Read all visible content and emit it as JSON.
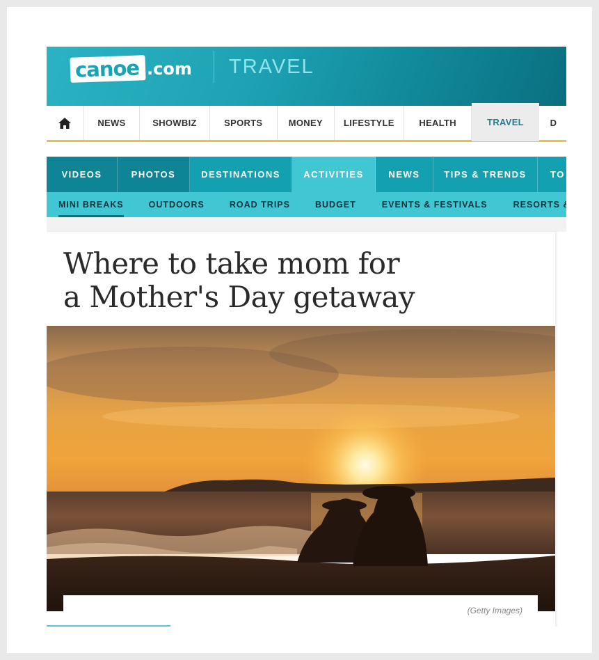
{
  "header": {
    "logo_main": "canoe",
    "logo_suffix": ".com",
    "section_title": "TRAVEL",
    "brand_color": "#1da2b3"
  },
  "main_nav": {
    "home_icon": "home-icon",
    "items": [
      "NEWS",
      "SHOWBIZ",
      "SPORTS",
      "MONEY",
      "LIFESTYLE",
      "HEALTH",
      "TRAVEL",
      "D"
    ],
    "active": "TRAVEL",
    "underline_color": "#e9c24a"
  },
  "section_nav": {
    "items": [
      "VIDEOS",
      "PHOTOS",
      "DESTINATIONS",
      "ACTIVITIES",
      "NEWS",
      "TIPS & TRENDS",
      "TO"
    ],
    "active": "ACTIVITIES"
  },
  "sub_nav": {
    "items": [
      "MINI BREAKS",
      "OUTDOORS",
      "ROAD TRIPS",
      "BUDGET",
      "EVENTS & FESTIVALS",
      "RESORTS & CR"
    ],
    "active": "MINI BREAKS"
  },
  "article": {
    "headline_line1": "Where to take mom for",
    "headline_line2": "a Mother's Day getaway",
    "photo_alt": "Two women in sun hats sitting on a beach at sunset",
    "caption": "(Getty Images)"
  }
}
